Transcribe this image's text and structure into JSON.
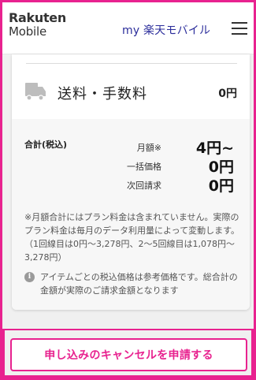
{
  "header": {
    "logo_line1": "Rakuten",
    "logo_line2": "Mobile",
    "brand_title": "my 楽天モバイル"
  },
  "shipping": {
    "label": "送料・手数料",
    "value": "0円"
  },
  "summary": {
    "total_label": "合計(税込)",
    "rows": [
      {
        "label": "月額※",
        "value": "4円~"
      },
      {
        "label": "一括価格",
        "value": "0円"
      },
      {
        "label": "次回請求",
        "value": "0円"
      }
    ],
    "note": "※月額合計にはプラン料金は含まれていません。実際のプラン料金は毎月のデータ利用量によって変動します。（1回線目は0円〜3,278円、2〜5回線目は1,078円〜3,278円）",
    "info": "アイテムごとの税込価格は参考価格です。総合計の金額が実際のご請求金額となります"
  },
  "cancel": {
    "label": "申し込みのキャンセルを申請する"
  },
  "colors": {
    "accent": "#e8228f",
    "brand": "#2b2d9b"
  }
}
